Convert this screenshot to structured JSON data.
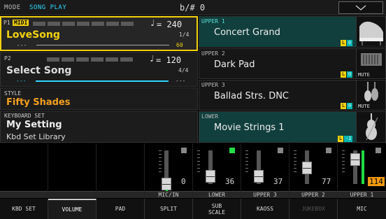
{
  "topbar": {
    "mode_label": "MODE",
    "mode_value": "SONG PLAY",
    "transpose_label": "b/#",
    "transpose_value": "0"
  },
  "player1": {
    "tag": "P1",
    "midi": "MIDI",
    "song": "LoveSong",
    "tempo": "= 240",
    "meter": "1/4",
    "time_left": "---",
    "time_right": "60"
  },
  "player2": {
    "tag": "P2",
    "song": "Select Song",
    "tempo": "= 120",
    "meter": "4/4",
    "time_left": "---",
    "time_right": "---"
  },
  "style": {
    "tag": "STYLE",
    "name": "Fifty Shades"
  },
  "keyboard_set": {
    "tag": "KEYBOARD SET",
    "name": "My Setting",
    "library": "Kbd Set Library"
  },
  "sounds": [
    {
      "tag": "UPPER 1",
      "name": "Concert Grand",
      "kb_l": "L",
      "kb_n": "0",
      "mute": ""
    },
    {
      "tag": "UPPER 2",
      "name": "Dark Pad",
      "kb_l": "L",
      "kb_n": "0",
      "mute": "MUTE"
    },
    {
      "tag": "UPPER 3",
      "name": "Ballad Strs. DNC",
      "kb_l": "L",
      "kb_n": "0",
      "mute": "MUTE"
    },
    {
      "tag": "LOWER",
      "name": "Movie Strings 1",
      "kb_l": "L",
      "kb_n": "-1",
      "mute": ""
    }
  ],
  "mixer": [
    {
      "label": "",
      "value": "",
      "level": 0
    },
    {
      "label": "",
      "value": "",
      "level": 0
    },
    {
      "label": "",
      "value": "",
      "level": 0
    },
    {
      "label": "MIC/IN",
      "value": "0",
      "level": 0.0
    },
    {
      "label": "LOWER",
      "value": "36",
      "level": 0.28
    },
    {
      "label": "UPPER 3",
      "value": "37",
      "level": 0.29
    },
    {
      "label": "UPPER 2",
      "value": "77",
      "level": 0.6
    },
    {
      "label": "UPPER 1",
      "value": "114",
      "level": 0.9
    }
  ],
  "tabs": [
    "KBD SET",
    "VOLUME",
    "PAD",
    "SPLIT",
    "SUB\nSCALE",
    "KAOSS",
    "JUKEBOX",
    "MIC"
  ],
  "colors": {
    "accent_yellow": "#f3d210",
    "accent_cyan": "#2fd6ff",
    "selected_teal": "#103f3d",
    "green": "#22dd44"
  }
}
